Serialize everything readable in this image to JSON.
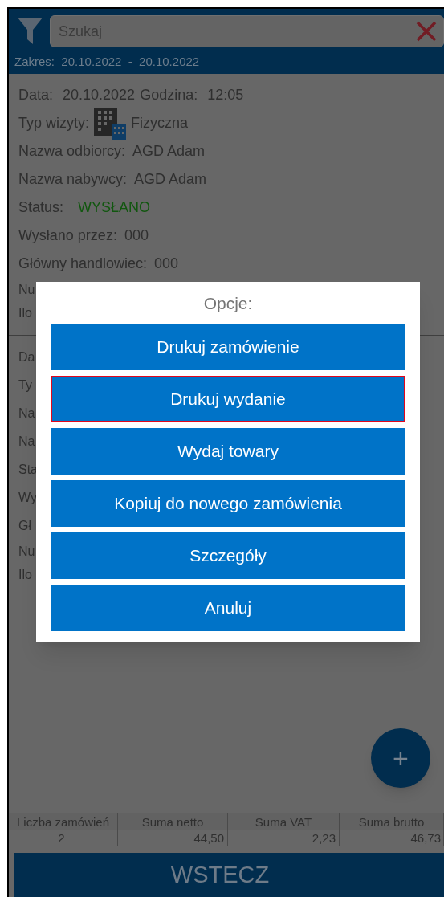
{
  "search": {
    "placeholder": "Szukaj"
  },
  "range": "Zakres:  20.10.2022  -  20.10.2022",
  "orders": [
    {
      "rows": [
        {
          "kind": "datetime",
          "label": "Data:",
          "value": "20.10.2022",
          "label2": "Godzina:",
          "value2": "12:05"
        },
        {
          "kind": "visit",
          "label": "Typ wizyty:",
          "value": "Fizyczna"
        },
        {
          "kind": "pair",
          "label": "Nazwa odbiorcy:",
          "value": "AGD Adam"
        },
        {
          "kind": "pair",
          "label": "Nazwa nabywcy:",
          "value": "AGD Adam"
        },
        {
          "kind": "status",
          "label": "Status:",
          "value": "WYSŁANO"
        },
        {
          "kind": "pair",
          "label": "Wysłano przez:",
          "value": "000"
        },
        {
          "kind": "pair",
          "label": "Główny handlowiec:",
          "value": "000"
        },
        {
          "kind": "fragment",
          "text": "Nu"
        },
        {
          "kind": "fragment",
          "text": "Ilo"
        }
      ]
    },
    {
      "rows": [
        {
          "kind": "fragment",
          "text": "Da"
        },
        {
          "kind": "fragment",
          "text": "Ty"
        },
        {
          "kind": "fragment",
          "text": "Na"
        },
        {
          "kind": "fragment",
          "text": "Na"
        },
        {
          "kind": "fragment",
          "text": "Sta"
        },
        {
          "kind": "fragment",
          "text": "Wy"
        },
        {
          "kind": "fragment",
          "text": "Gł"
        },
        {
          "kind": "fragment",
          "text": "Nu"
        },
        {
          "kind": "fragment",
          "text": "Ilo"
        }
      ]
    }
  ],
  "fab": "+",
  "totals": {
    "columns": [
      "Liczba zamówień",
      "Suma netto",
      "Suma VAT",
      "Suma brutto"
    ],
    "values": [
      "2",
      "44,50",
      "2,23",
      "46,73"
    ]
  },
  "back_button": "WSTECZ",
  "dialog": {
    "title": "Opcje:",
    "options": [
      {
        "label": "Drukuj zamówienie",
        "selected": false
      },
      {
        "label": "Drukuj wydanie",
        "selected": true
      },
      {
        "label": "Wydaj towary",
        "selected": false
      },
      {
        "label": "Kopiuj do nowego zamówienia",
        "selected": false
      },
      {
        "label": "Szczegóły",
        "selected": false
      },
      {
        "label": "Anuluj",
        "selected": false
      }
    ]
  }
}
